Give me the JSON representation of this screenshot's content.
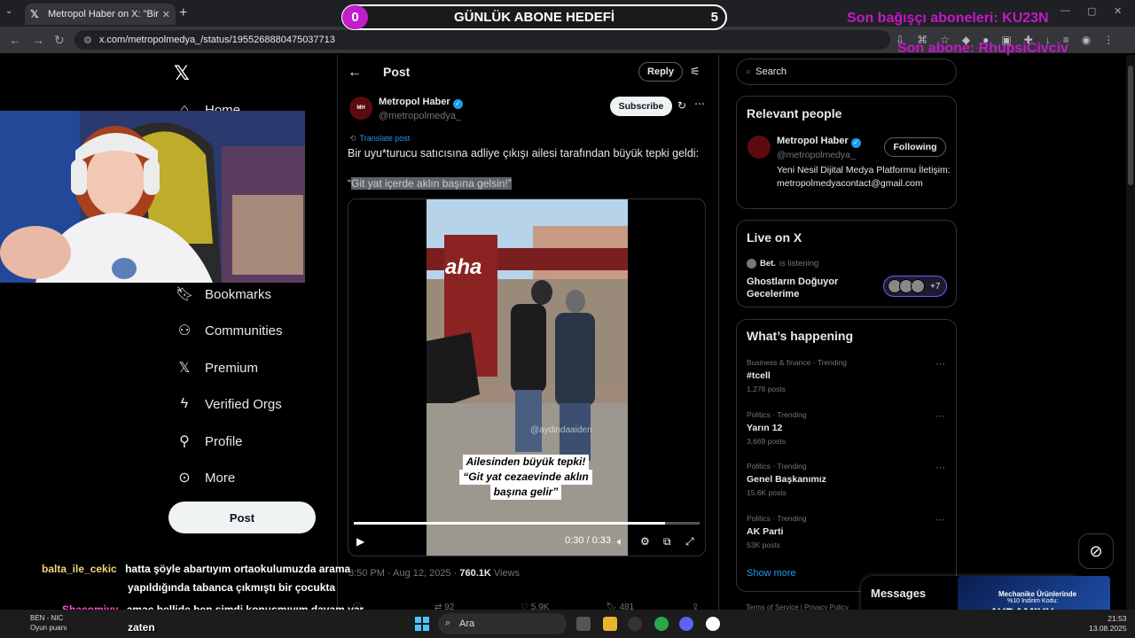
{
  "browser": {
    "tab_title": "Metropol Haber on X: \"Bir uyu*tu",
    "url": "x.com/metropolmedya_/status/1955268880475037713"
  },
  "overlay": {
    "goal_title": "GÜNLÜK ABONE HEDEFİ",
    "goal_current": "0",
    "goal_target": "5",
    "last_donor": "Son bağışçı aboneleri: KU23N",
    "last_sub": "Son abone: RhupsiCivciv"
  },
  "nav": {
    "items": [
      {
        "label": "Home",
        "icon": "home-icon"
      },
      {
        "label": "Bookmarks",
        "icon": "bookmark-icon"
      },
      {
        "label": "Communities",
        "icon": "communities-icon"
      },
      {
        "label": "Premium",
        "icon": "x-icon"
      },
      {
        "label": "Verified Orgs",
        "icon": "lightning-icon"
      },
      {
        "label": "Profile",
        "icon": "person-icon"
      },
      {
        "label": "More",
        "icon": "more-circle-icon"
      }
    ],
    "post_button": "Post"
  },
  "post_header": {
    "title": "Post",
    "reply": "Reply"
  },
  "tweet": {
    "author_name": "Metropol Haber",
    "author_handle": "@metropolmedya_",
    "subscribe": "Subscribe",
    "translate": "Translate post",
    "text": "Bir uyu*turucu satıcısına adliye çıkışı ailesi tarafından büyük tepki geldi:",
    "quote_open": "“",
    "quote": "Git yat içerde aklın başına gelsin!”",
    "video_logo": "aha",
    "video_watermark": "@aydindaaiden",
    "video_caption": [
      "Ailesinden büyük tepki!",
      "“Git yat cezaevinde aklın",
      "başına gelir”"
    ],
    "video_time": "0:30 / 0:33",
    "video_progress": 0.9,
    "time": "3:50 PM · Aug 12, 2025 · ",
    "views": "760.1K",
    "views_label": " Views",
    "reposts": "92",
    "likes": "5.9K",
    "bookmarks": "481"
  },
  "right": {
    "search_placeholder": "Search",
    "relevant_title": "Relevant people",
    "relevant": {
      "name": "Metropol Haber",
      "handle": "@metropolmedya_",
      "bio": "Yeni Nesil Dijital Medya Platformu İletişim:metropolmedyacontact@gmail.com",
      "follow": "Following"
    },
    "live_title": "Live on X",
    "live": {
      "host": "Bet.",
      "status": "is listening",
      "room": "Ghostların Doğuyor Gecelerime",
      "extra": "+7"
    },
    "happening_title": "What’s happening",
    "trends": [
      {
        "meta": "Business & finance · Trending",
        "name": "#tcell",
        "count": "1,278 posts"
      },
      {
        "meta": "Politics · Trending",
        "name": "Yarın 12",
        "count": "3,669 posts"
      },
      {
        "meta": "Politics · Trending",
        "name": "Genel Başkanımız",
        "count": "15.6K posts"
      },
      {
        "meta": "Politics · Trending",
        "name": "AK Parti",
        "count": "53K posts"
      }
    ],
    "show_more": "Show more",
    "footer": "Terms of Service  |  Privacy Policy"
  },
  "messages": "Messages",
  "promo": {
    "line1": "Mechanike Ürünlerinde",
    "line2": "%10 İndirim Kodu:",
    "code": "AYDAMIYY"
  },
  "chat": [
    {
      "user": "balta_ile_cekic",
      "text": "hatta şöyle abartıyım ortaokulumuzda arama"
    },
    {
      "user": "",
      "text": "yapıldığında tabanca çıkmıştı bir çocukta"
    },
    {
      "user": "Shacomiyy",
      "text": "amaç bellide ben şimdi konusmıyım davam var"
    },
    {
      "user": "",
      "text": "zaten"
    }
  ],
  "taskbar": {
    "search": "Ara",
    "time": "21:53",
    "date": "13.08.2025",
    "game_line1": "BEN - NIC",
    "game_line2": "Oyun puanı"
  }
}
